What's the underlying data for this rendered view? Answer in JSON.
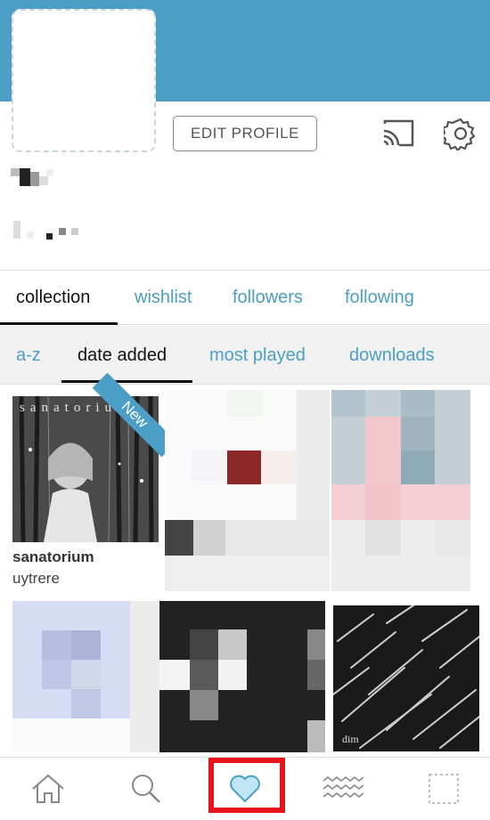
{
  "profile": {
    "edit_label": "EDIT PROFILE",
    "accent_color": "#4b9ec5"
  },
  "tabs_primary": [
    {
      "label": "collection",
      "active": true
    },
    {
      "label": "wishlist",
      "active": false
    },
    {
      "label": "followers",
      "active": false
    },
    {
      "label": "following",
      "active": false
    }
  ],
  "tabs_secondary": [
    {
      "label": "a-z",
      "active": false
    },
    {
      "label": "date added",
      "active": true
    },
    {
      "label": "most played",
      "active": false
    },
    {
      "label": "downloads",
      "active": false
    }
  ],
  "collection": [
    {
      "title": "sanatorium",
      "artist": "uytrere",
      "badge": "New",
      "cover_text": "sanatorium"
    },
    {
      "cover_text": ""
    },
    {
      "cover_text": ""
    },
    {
      "cover_text": ""
    },
    {
      "cover_text": ""
    },
    {
      "cover_text": "dim"
    }
  ],
  "nav": [
    {
      "icon": "home-icon"
    },
    {
      "icon": "search-icon"
    },
    {
      "icon": "heart-icon",
      "active": true
    },
    {
      "icon": "feed-wave-icon"
    },
    {
      "icon": "profile-icon"
    }
  ]
}
